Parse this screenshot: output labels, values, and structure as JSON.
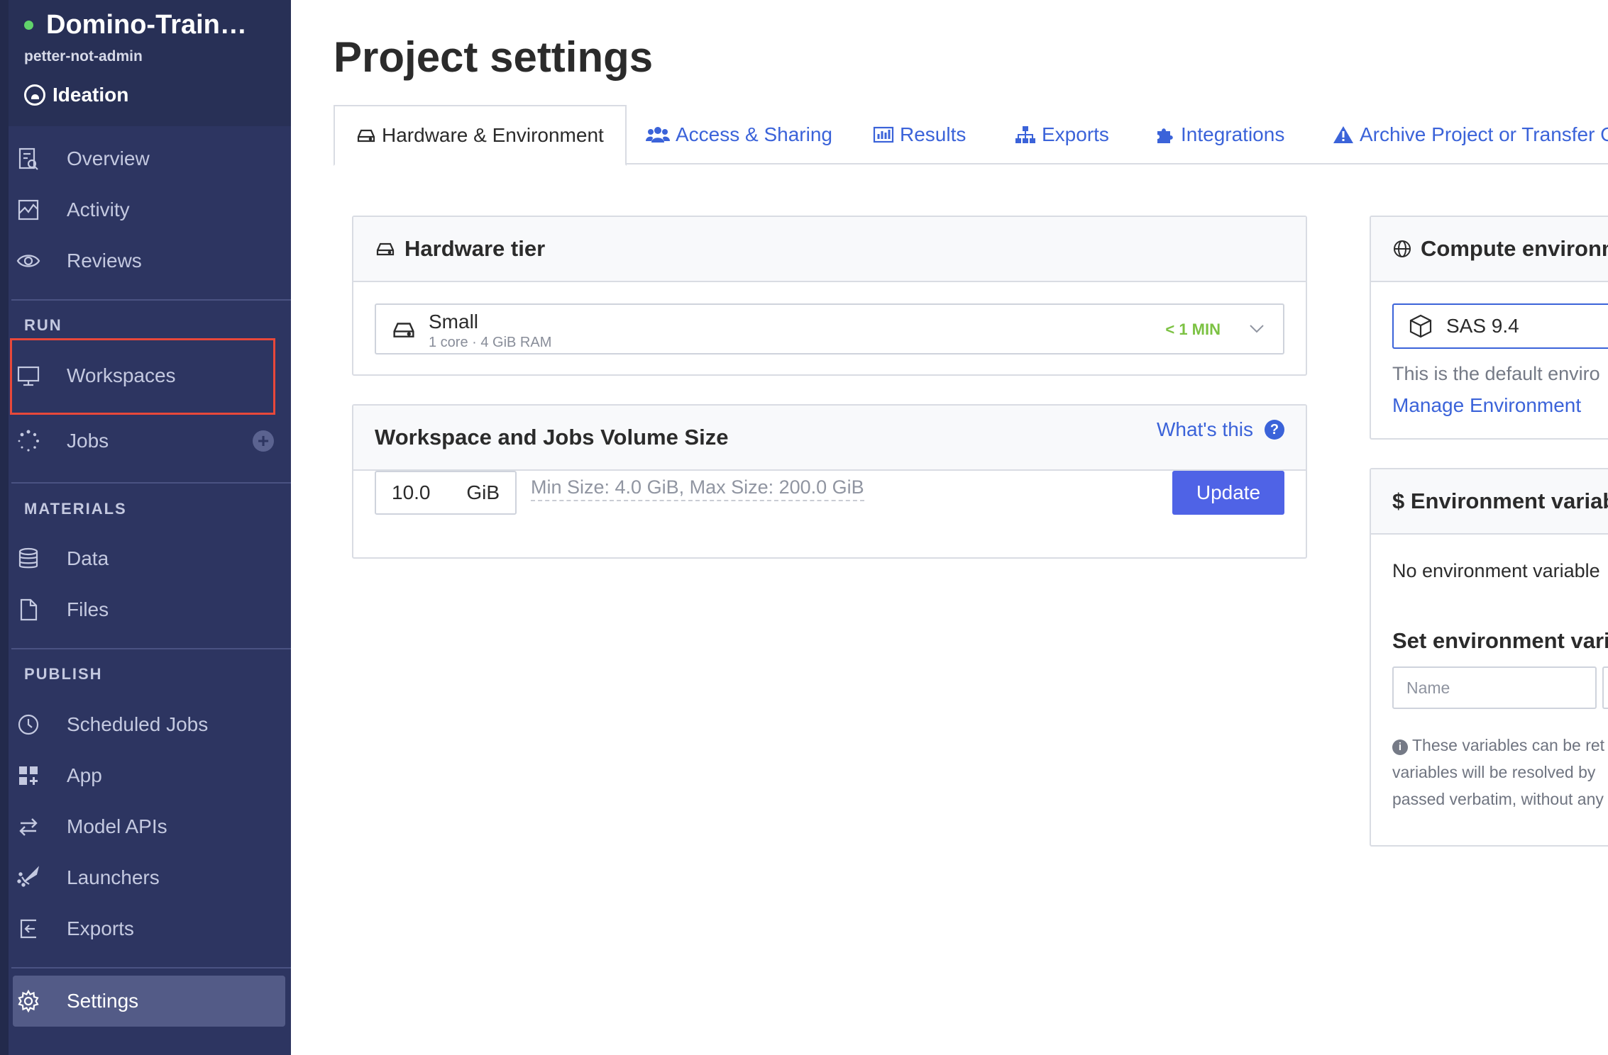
{
  "project": {
    "name": "Domino-Train…",
    "owner": "petter-not-admin",
    "stage": "Ideation",
    "status_color": "#61d36b"
  },
  "sidebar": {
    "top_items": [
      {
        "label": "Overview",
        "icon": "overview-icon"
      },
      {
        "label": "Activity",
        "icon": "activity-icon"
      },
      {
        "label": "Reviews",
        "icon": "eye-icon"
      }
    ],
    "run": {
      "title": "RUN",
      "items": [
        {
          "label": "Workspaces",
          "icon": "monitor-icon"
        },
        {
          "label": "Jobs",
          "icon": "spinner-icon"
        }
      ]
    },
    "materials": {
      "title": "MATERIALS",
      "items": [
        {
          "label": "Data",
          "icon": "database-icon"
        },
        {
          "label": "Files",
          "icon": "file-icon"
        }
      ]
    },
    "publish": {
      "title": "PUBLISH",
      "items": [
        {
          "label": "Scheduled Jobs",
          "icon": "clock-icon"
        },
        {
          "label": "App",
          "icon": "app-grid-icon"
        },
        {
          "label": "Model APIs",
          "icon": "arrows-icon"
        },
        {
          "label": "Launchers",
          "icon": "rocket-icon"
        },
        {
          "label": "Exports",
          "icon": "export-icon"
        }
      ]
    },
    "settings": {
      "label": "Settings",
      "icon": "gear-icon"
    },
    "jobs_add": "+"
  },
  "page": {
    "title": "Project settings"
  },
  "tabs": [
    {
      "label": "Hardware & Environment",
      "icon": "hard-drive-icon",
      "active": true
    },
    {
      "label": "Access & Sharing",
      "icon": "users-icon",
      "active": false
    },
    {
      "label": "Results",
      "icon": "bar-chart-icon",
      "active": false
    },
    {
      "label": "Exports",
      "icon": "sitemap-icon",
      "active": false
    },
    {
      "label": "Integrations",
      "icon": "puzzle-icon",
      "active": false
    },
    {
      "label": "Archive Project or Transfer O",
      "icon": "warning-icon",
      "active": false
    }
  ],
  "hardware": {
    "title": "Hardware tier",
    "tier_name": "Small",
    "tier_spec": "1 core · 4 GiB RAM",
    "wait": "< 1 MIN"
  },
  "volume": {
    "title": "Workspace and Jobs Volume Size",
    "help_link": "What's this",
    "help_badge": "?",
    "value": "10.0",
    "unit": "GiB",
    "hint": "Min Size: 4.0 GiB, Max Size: 200.0 GiB",
    "update_label": "Update"
  },
  "compute": {
    "title": "Compute environm",
    "selected": "SAS 9.4",
    "description": "This is the default enviro",
    "manage_link": "Manage Environment"
  },
  "env_vars": {
    "title": "$ Environment variab",
    "empty_text": "No environment variable",
    "set_title": "Set environment varia",
    "name_placeholder": "Name",
    "note_line1": "These variables can be ret",
    "note_line2": "variables will be resolved by",
    "note_line3": "passed verbatim, without any"
  },
  "colors": {
    "sidebar_bg": "#2d3561",
    "accent_link": "#3b63d9",
    "primary_button": "#4f63e6",
    "highlight_border": "#e8483a",
    "wait_green": "#7cc243"
  }
}
